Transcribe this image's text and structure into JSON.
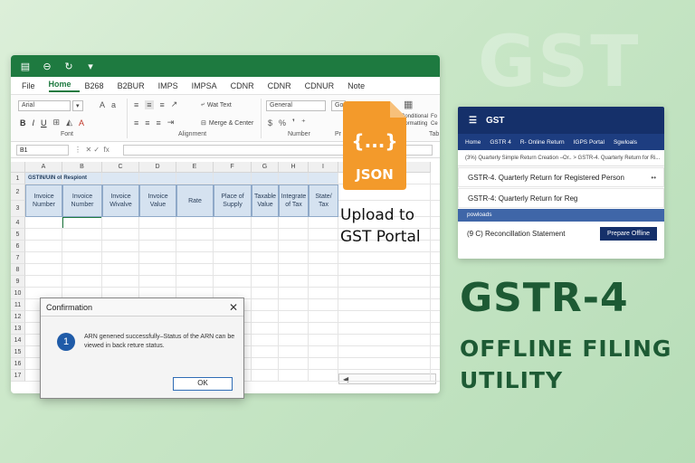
{
  "watermark": "GST",
  "excel": {
    "menu": [
      "File",
      "Home",
      "B268",
      "B2BUR",
      "IMPS",
      "IMPSA",
      "CDNR",
      "CDNR",
      "CDNUR",
      "Note"
    ],
    "active_menu_index": 1,
    "ribbon": {
      "font_name": "Arial",
      "number_format": "General",
      "wrap_text": "Wat Text",
      "merge_center": "Merge & Center",
      "cond_format_1": "Conditional",
      "cond_format_2": "Formatting",
      "fo_1": "Fo",
      "fo_2": "Ce",
      "group_font": "Font",
      "group_alignment": "Alignment",
      "group_number": "Number",
      "group_styles": "Pr",
      "group_tab": "Tab"
    },
    "name_box": "B1",
    "columns": [
      "A",
      "B",
      "C",
      "D",
      "E",
      "F",
      "G",
      "H",
      "I",
      "L"
    ],
    "rows": [
      "1",
      "2",
      "3",
      "4",
      "5",
      "6",
      "7",
      "8",
      "9",
      "10",
      "11",
      "12",
      "13",
      "14",
      "15",
      "16",
      "17"
    ],
    "gstin_label": "GSTIN/UIN of Respiont",
    "headers": [
      "Invoice Number",
      "Invoice Number",
      "Invoice Wivalve",
      "Invoice Value",
      "Rate",
      "Place of Supply",
      "Taxable Value",
      "Integrate of Tax",
      "State/ Tax"
    ]
  },
  "dialog": {
    "title": "Confirmation",
    "message": "ARN genened successfully–Status of the ARN can be viewed in back reture status.",
    "ok_label": "OK",
    "icon_glyph": "1"
  },
  "json_icon": {
    "braces": "{...}",
    "label": "JSON",
    "color": "#f39a2b"
  },
  "upload_text": {
    "line1": "Upload to",
    "line2": "GST Portal"
  },
  "portal": {
    "title": "GST",
    "nav": [
      "Home",
      "GSTR 4",
      "R- Online Return",
      "IGPS Portal",
      "Sgwloals"
    ],
    "breadcrumb": "(3%) Quarterly Simple Return Creation  –Or..  >  GSTR-4. Quarterly Return for Ri...",
    "row1": "GSTR-4. Quarterly Return for Registered Person",
    "row1_dots": "••",
    "row2": "GSTR-4: Quarterly Return for Reg",
    "band": "powloads",
    "row3": "(9 C) Reconcillation Statement",
    "button": "Prepare Offline"
  },
  "headline": {
    "title": "GSTR-4",
    "line1": "OFFLINE FILING",
    "line2": "UTILITY",
    "color": "#1d5a34"
  }
}
